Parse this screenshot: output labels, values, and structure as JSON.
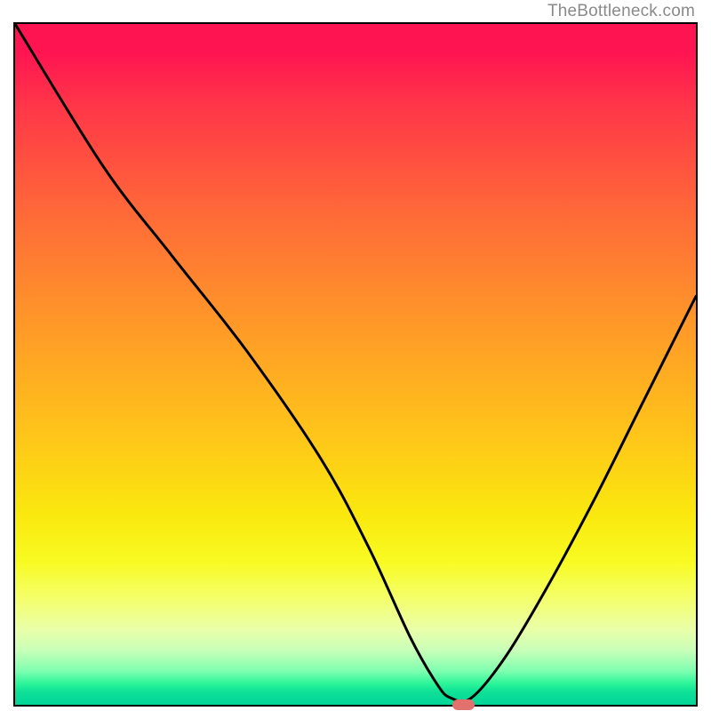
{
  "watermark": "TheBottleneck.com",
  "chart_data": {
    "type": "line",
    "title": "",
    "xlabel": "",
    "ylabel": "",
    "ylim": [
      0,
      100
    ],
    "xlim": [
      0,
      100
    ],
    "series": [
      {
        "name": "curve",
        "x": [
          0,
          13,
          23,
          34,
          45,
          52,
          58,
          62,
          64,
          67,
          72,
          78,
          85,
          92,
          100
        ],
        "values": [
          100,
          79,
          66,
          52,
          36,
          23,
          10,
          3,
          1,
          1,
          7,
          17,
          30,
          44,
          60
        ]
      }
    ],
    "marker": {
      "x": 65.5,
      "y": 0.5,
      "width_pct": 3.2,
      "height_pct": 1.5
    },
    "colors": {
      "curve": "#000000",
      "marker": "#e2706d",
      "gradient_top": "#ff1452",
      "gradient_bottom": "#00d498"
    }
  }
}
